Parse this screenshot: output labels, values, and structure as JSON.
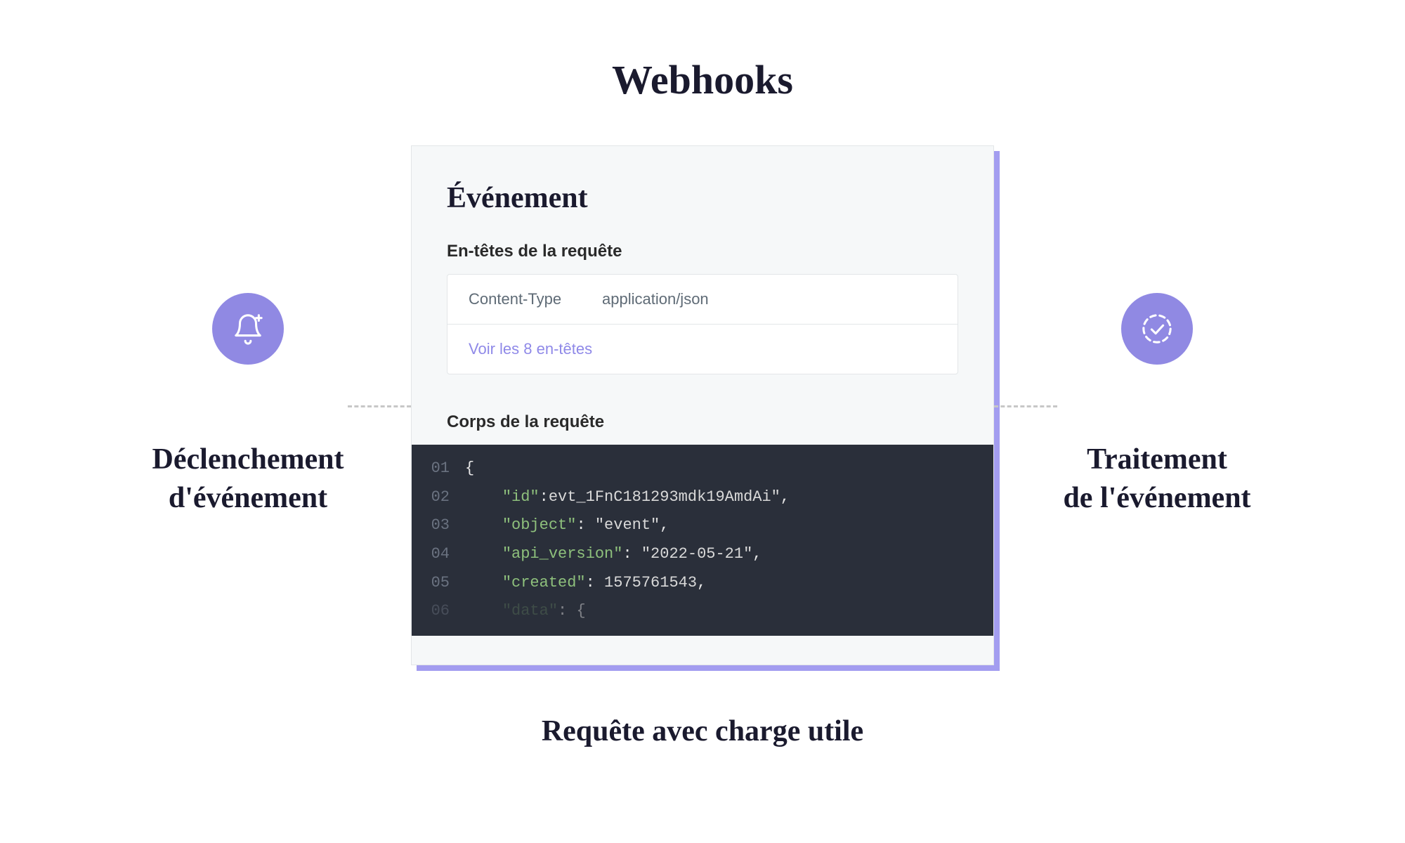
{
  "title": "Webhooks",
  "left": {
    "label": "Déclenchement\nd'événement",
    "icon": "bell-plus-icon"
  },
  "right": {
    "label": "Traitement\nde l'événement",
    "icon": "check-dashed-icon"
  },
  "card": {
    "title": "Événement",
    "headers_label": "En-têtes de la requête",
    "header_row": {
      "key": "Content-Type",
      "value": "application/json"
    },
    "headers_link": "Voir les 8 en-têtes",
    "body_label": "Corps de la requête",
    "code_lines": {
      "l1": {
        "num": "01",
        "text": "{"
      },
      "l2": {
        "num": "02",
        "indent": "    ",
        "key": "\"id\"",
        "sep": ":",
        "value": "evt_1FnC181293mdk19AmdAi\"",
        "trail": ","
      },
      "l3": {
        "num": "03",
        "indent": "    ",
        "key": "\"object\"",
        "sep": ": ",
        "value": "\"event\"",
        "trail": ","
      },
      "l4": {
        "num": "04",
        "indent": "    ",
        "key": "\"api_version\"",
        "sep": ": ",
        "value": "\"2022-05-21\"",
        "trail": ","
      },
      "l5": {
        "num": "05",
        "indent": "    ",
        "key": "\"created\"",
        "sep": ": ",
        "value": "1575761543",
        "trail": ","
      },
      "l6": {
        "num": "06",
        "indent": "    ",
        "key": "\"data\"",
        "sep": ": ",
        "value": "{"
      }
    }
  },
  "bottom_caption": "Requête avec charge utile"
}
